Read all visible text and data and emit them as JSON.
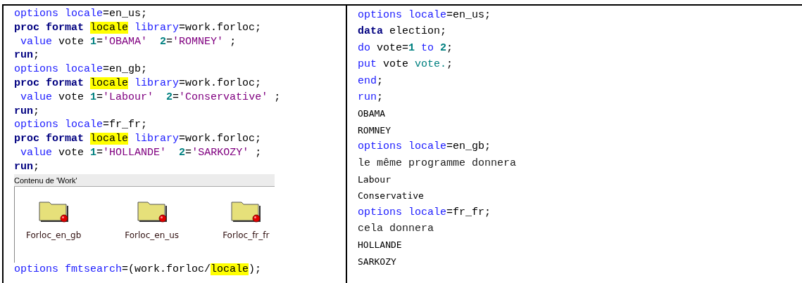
{
  "left": {
    "lines_before": [
      {
        "tokens": [
          {
            "kind": "kw",
            "text": "options locale"
          },
          {
            "kind": "plain",
            "text": "=en_us;"
          }
        ]
      },
      {
        "tokens": [
          {
            "kind": "proc",
            "text": "proc format "
          },
          {
            "kind": "hl",
            "text": "locale"
          },
          {
            "kind": "kw",
            "text": " library"
          },
          {
            "kind": "plain",
            "text": "=work.forloc;"
          }
        ]
      },
      {
        "tokens": [
          {
            "kind": "kw",
            "text": " value"
          },
          {
            "kind": "plain",
            "text": " vote "
          },
          {
            "kind": "num",
            "text": "1"
          },
          {
            "kind": "plain",
            "text": "="
          },
          {
            "kind": "str",
            "text": "'OBAMA'  "
          },
          {
            "kind": "num",
            "text": "2"
          },
          {
            "kind": "plain",
            "text": "="
          },
          {
            "kind": "str",
            "text": "'ROMNEY'"
          },
          {
            "kind": "plain",
            "text": " ;"
          }
        ]
      },
      {
        "tokens": [
          {
            "kind": "proc",
            "text": "run"
          },
          {
            "kind": "plain",
            "text": ";"
          }
        ]
      },
      {
        "tokens": [
          {
            "kind": "kw",
            "text": "options locale"
          },
          {
            "kind": "plain",
            "text": "=en_gb;"
          }
        ]
      },
      {
        "tokens": [
          {
            "kind": "proc",
            "text": "proc format "
          },
          {
            "kind": "hl",
            "text": "locale"
          },
          {
            "kind": "kw",
            "text": " library"
          },
          {
            "kind": "plain",
            "text": "=work.forloc;"
          }
        ]
      },
      {
        "tokens": [
          {
            "kind": "kw",
            "text": " value"
          },
          {
            "kind": "plain",
            "text": " vote "
          },
          {
            "kind": "num",
            "text": "1"
          },
          {
            "kind": "plain",
            "text": "="
          },
          {
            "kind": "str",
            "text": "'Labour'  "
          },
          {
            "kind": "num",
            "text": "2"
          },
          {
            "kind": "plain",
            "text": "="
          },
          {
            "kind": "str",
            "text": "'Conservative'"
          },
          {
            "kind": "plain",
            "text": " ;"
          }
        ]
      },
      {
        "tokens": [
          {
            "kind": "proc",
            "text": "run"
          },
          {
            "kind": "plain",
            "text": ";"
          }
        ]
      },
      {
        "tokens": [
          {
            "kind": "kw",
            "text": "options locale"
          },
          {
            "kind": "plain",
            "text": "=fr_fr;"
          }
        ]
      },
      {
        "tokens": [
          {
            "kind": "proc",
            "text": "proc format "
          },
          {
            "kind": "hl",
            "text": "locale"
          },
          {
            "kind": "kw",
            "text": " library"
          },
          {
            "kind": "plain",
            "text": "=work.forloc;"
          }
        ]
      },
      {
        "tokens": [
          {
            "kind": "kw",
            "text": " value"
          },
          {
            "kind": "plain",
            "text": " vote "
          },
          {
            "kind": "num",
            "text": "1"
          },
          {
            "kind": "plain",
            "text": "="
          },
          {
            "kind": "str",
            "text": "'HOLLANDE'  "
          },
          {
            "kind": "num",
            "text": "2"
          },
          {
            "kind": "plain",
            "text": "="
          },
          {
            "kind": "str",
            "text": "'SARKOZY'"
          },
          {
            "kind": "plain",
            "text": " ;"
          }
        ]
      },
      {
        "tokens": [
          {
            "kind": "proc",
            "text": "run"
          },
          {
            "kind": "plain",
            "text": ";"
          }
        ]
      }
    ],
    "window": {
      "title": "Contenu de 'Work'",
      "items": [
        "Forloc_en_gb",
        "Forloc_en_us",
        "Forloc_fr_fr"
      ]
    },
    "lines_after": [
      {
        "tokens": [
          {
            "kind": "kw",
            "text": "options fmtsearch"
          },
          {
            "kind": "plain",
            "text": "=(work.forloc/"
          },
          {
            "kind": "hl",
            "text": "locale"
          },
          {
            "kind": "plain",
            "text": ");"
          }
        ]
      }
    ]
  },
  "right": {
    "lines": [
      {
        "tokens": [
          {
            "kind": "kw",
            "text": "options locale"
          },
          {
            "kind": "plain",
            "text": "=en_us;"
          }
        ]
      },
      {
        "tokens": [
          {
            "kind": "proc",
            "text": "data"
          },
          {
            "kind": "plain",
            "text": " election;"
          }
        ]
      },
      {
        "tokens": [
          {
            "kind": "kw",
            "text": "do"
          },
          {
            "kind": "plain",
            "text": " vote="
          },
          {
            "kind": "num",
            "text": "1"
          },
          {
            "kind": "kw",
            "text": " to "
          },
          {
            "kind": "num",
            "text": "2"
          },
          {
            "kind": "plain",
            "text": ";"
          }
        ]
      },
      {
        "tokens": [
          {
            "kind": "kw",
            "text": "put"
          },
          {
            "kind": "plain",
            "text": " vote "
          },
          {
            "kind": "fmt",
            "text": "vote."
          },
          {
            "kind": "plain",
            "text": ";"
          }
        ]
      },
      {
        "tokens": [
          {
            "kind": "kw",
            "text": "end"
          },
          {
            "kind": "plain",
            "text": ";"
          }
        ]
      },
      {
        "tokens": [
          {
            "kind": "kw",
            "text": "run"
          },
          {
            "kind": "plain",
            "text": ";"
          }
        ]
      },
      {
        "tokens": [
          {
            "kind": "out",
            "text": "OBAMA"
          }
        ]
      },
      {
        "tokens": [
          {
            "kind": "out",
            "text": "ROMNEY"
          }
        ]
      },
      {
        "tokens": [
          {
            "kind": "kw",
            "text": "options locale"
          },
          {
            "kind": "plain",
            "text": "=en_gb;"
          }
        ]
      },
      {
        "tokens": [
          {
            "kind": "comment",
            "text": "le même programme donnera"
          }
        ]
      },
      {
        "tokens": [
          {
            "kind": "out",
            "text": "Labour"
          }
        ]
      },
      {
        "tokens": [
          {
            "kind": "out",
            "text": "Conservative"
          }
        ]
      },
      {
        "tokens": [
          {
            "kind": "kw",
            "text": "options locale"
          },
          {
            "kind": "plain",
            "text": "=fr_fr;"
          }
        ]
      },
      {
        "tokens": [
          {
            "kind": "comment",
            "text": "cela donnera"
          }
        ]
      },
      {
        "tokens": [
          {
            "kind": "out",
            "text": "HOLLANDE"
          }
        ]
      },
      {
        "tokens": [
          {
            "kind": "out",
            "text": "SARKOZY"
          }
        ]
      }
    ]
  }
}
